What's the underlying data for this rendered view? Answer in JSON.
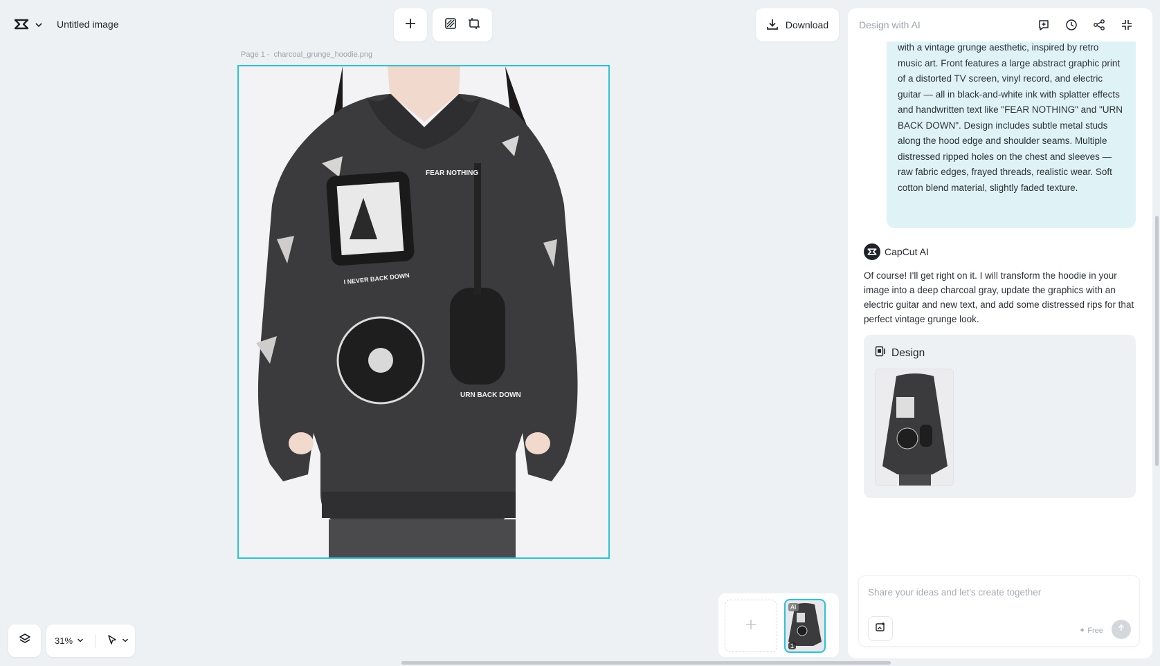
{
  "app": {
    "title": "Untitled image"
  },
  "toolbar": {
    "download_label": "Download"
  },
  "canvas": {
    "page_prefix": "Page 1 -",
    "file_name": "charcoal_grunge_hoodie.png",
    "print_text_1": "FEAR NOTHING",
    "print_text_2": "I NEVER BACK DOWN",
    "print_text_3": "URN BACK DOWN"
  },
  "zoom": {
    "value": "31%"
  },
  "pages": {
    "ai_badge": "AI",
    "page_number": "1"
  },
  "panel": {
    "title": "Design with AI",
    "user_prompt": "with a vintage grunge aesthetic, inspired by retro music art. Front features a large abstract graphic print of a distorted TV screen, vinyl record, and electric guitar — all in black-and-white ink with splatter effects and handwritten text like \"FEAR NOTHING\" and \"URN BACK DOWN\". Design includes subtle metal studs along the hood edge and shoulder seams. Multiple distressed ripped holes on the chest and sleeves — raw fabric edges, frayed threads, realistic wear. Soft cotton blend material, slightly faded texture.",
    "ai_name": "CapCut AI",
    "ai_response": "Of course! I'll get right on it. I will transform the hoodie in your image into a deep charcoal gray, update the graphics with an electric guitar and new text, and add some distressed rips for that perfect vintage grunge look.",
    "design_label": "Design",
    "input_placeholder": "Share your ideas and let's create together",
    "free_label": "✦ Free"
  },
  "colors": {
    "accent": "#2ac3d6",
    "bubble": "#dff3f6",
    "hoodie": "#3a3a3c"
  },
  "icons": [
    "capcut-logo-icon",
    "chevron-down-icon",
    "plus-icon",
    "eraser-icon",
    "crop-icon",
    "download-icon",
    "layers-icon",
    "pointer-icon",
    "new-chat-icon",
    "history-icon",
    "share-icon",
    "collapse-icon",
    "design-icon",
    "image-upload-icon",
    "send-icon"
  ]
}
